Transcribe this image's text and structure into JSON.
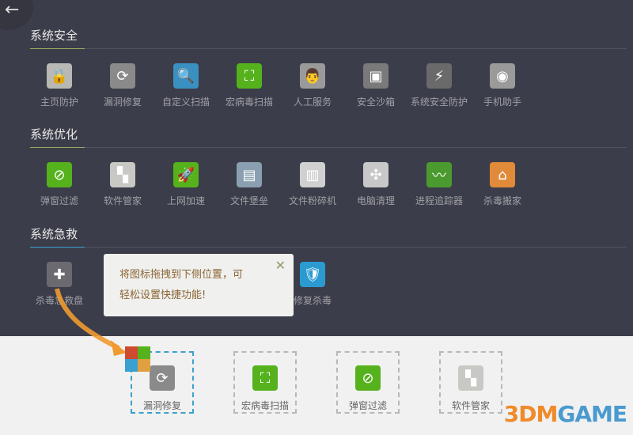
{
  "sections": [
    {
      "title": "系统安全",
      "accent": "#9aa860",
      "items": [
        {
          "label": "主页防护",
          "icon": "lock-icon",
          "color": "#b8b8b4",
          "glyph": "🔒"
        },
        {
          "label": "漏洞修复",
          "icon": "refresh-icon",
          "color": "#8a8a8a",
          "glyph": "⟳"
        },
        {
          "label": "自定义扫描",
          "icon": "magnifier-icon",
          "color": "#3a90c0",
          "glyph": "🔍"
        },
        {
          "label": "宏病毒扫描",
          "icon": "scan-icon",
          "color": "#55b21c",
          "glyph": "⛶"
        },
        {
          "label": "人工服务",
          "icon": "doctor-icon",
          "color": "#9a9a9a",
          "glyph": "👨"
        },
        {
          "label": "安全沙箱",
          "icon": "sandbox-icon",
          "color": "#7a7a7a",
          "glyph": "▣"
        },
        {
          "label": "系统安全防护",
          "icon": "lightning-icon",
          "color": "#6a6a6a",
          "glyph": "⚡"
        },
        {
          "label": "手机助手",
          "icon": "phone-icon",
          "color": "#9a9a9a",
          "glyph": "◉"
        }
      ]
    },
    {
      "title": "系统优化",
      "accent": "#9aa860",
      "items": [
        {
          "label": "弹窗过滤",
          "icon": "popup-block-icon",
          "color": "#55b21c",
          "glyph": "⊘"
        },
        {
          "label": "软件管家",
          "icon": "software-icon",
          "color": "#c8c8c4",
          "glyph": "▚"
        },
        {
          "label": "上网加速",
          "icon": "rocket-icon",
          "color": "#55b21c",
          "glyph": "🚀"
        },
        {
          "label": "文件堡垒",
          "icon": "file-vault-icon",
          "color": "#8aa0b0",
          "glyph": "▤"
        },
        {
          "label": "文件粉碎机",
          "icon": "shredder-icon",
          "color": "#d0d0d0",
          "glyph": "▥"
        },
        {
          "label": "电脑清理",
          "icon": "fan-icon",
          "color": "#c8c8c8",
          "glyph": "✣"
        },
        {
          "label": "进程追踪器",
          "icon": "process-icon",
          "color": "#4a9a30",
          "glyph": "〰"
        },
        {
          "label": "杀毒搬家",
          "icon": "house-icon",
          "color": "#e08a3a",
          "glyph": "⌂"
        }
      ]
    },
    {
      "title": "系统急救",
      "accent": "#3aa0d0",
      "items": [
        {
          "label": "杀毒急救盘",
          "icon": "rescue-disk-icon",
          "color": "#6a6a70",
          "glyph": "✚"
        },
        {
          "label": "修复杀毒",
          "icon": "shield-repair-icon",
          "color": "#2a9ad0",
          "glyph": "🛡"
        }
      ]
    }
  ],
  "tooltip": {
    "line1": "将图标拖拽到下侧位置，可",
    "line2": "轻松设置快捷功能!",
    "close": "✕"
  },
  "shortcuts": [
    {
      "label": "漏洞修复",
      "glyph": "⟳",
      "color": "#8a8a8a"
    },
    {
      "label": "宏病毒扫描",
      "glyph": "⛶",
      "color": "#55b21c"
    },
    {
      "label": "弹窗过滤",
      "glyph": "⊘",
      "color": "#55b21c"
    },
    {
      "label": "软件管家",
      "glyph": "▚",
      "color": "#c8c8c4"
    }
  ],
  "back": "←",
  "watermark": {
    "a": "3DM",
    "b": "GAME"
  }
}
